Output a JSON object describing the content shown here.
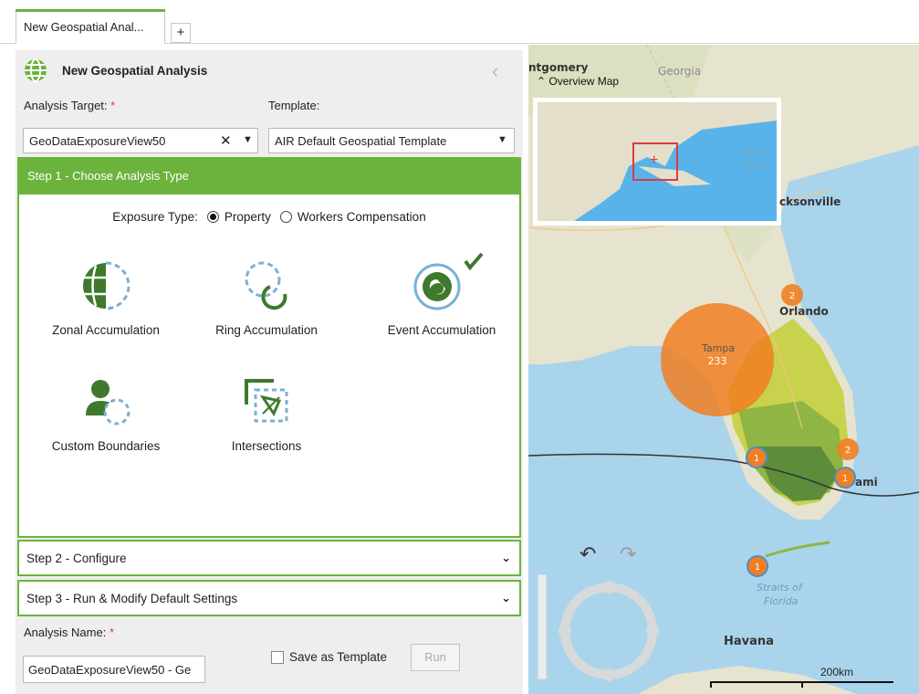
{
  "tabs": {
    "active_label": "New Geospatial Anal...",
    "add_label": "+"
  },
  "panel": {
    "title": "New Geospatial Analysis",
    "target_label": "Analysis Target:",
    "required_mark": "*",
    "target_value": "GeoDataExposureView50",
    "clear_symbol": "✕",
    "dropdown_symbol": "▼",
    "template_label": "Template:",
    "template_value": "AIR Default Geospatial Template"
  },
  "step1": {
    "title": "Step 1 - Choose Analysis Type",
    "exposure_label": "Exposure Type:",
    "exposure_options": [
      "Property",
      "Workers Compensation"
    ],
    "exposure_selected": "Property",
    "analysis_types": [
      {
        "label": "Zonal Accumulation",
        "icon": "zonal-accumulation-icon"
      },
      {
        "label": "Ring Accumulation",
        "icon": "ring-accumulation-icon"
      },
      {
        "label": "Event Accumulation",
        "icon": "event-accumulation-icon",
        "selected": true
      },
      {
        "label": "Custom Boundaries",
        "icon": "custom-boundaries-icon"
      },
      {
        "label": "Intersections",
        "icon": "intersections-icon"
      }
    ]
  },
  "step2": {
    "title": "Step 2 - Configure"
  },
  "step3": {
    "title": "Step 3 - Run & Modify Default Settings"
  },
  "footer": {
    "name_label": "Analysis Name:",
    "name_value": "GeoDataExposureView50 - Ge",
    "save_template_label": "Save as Template",
    "run_label": "Run"
  },
  "map": {
    "labels": {
      "montgomery": "ntgomery",
      "georgia": "Georgia",
      "overview_toggle": "Overview Map",
      "atlantic_1": "Atlan",
      "atlantic_2": "Ocea",
      "jacksonville": "cksonville",
      "orlando": "Orlando",
      "tampa": "Tampa",
      "miami": "ami",
      "straits_1": "Straits of",
      "straits_2": "Florida",
      "havana": "Havana",
      "scale": "200km"
    },
    "clusters": [
      {
        "name": "tampa-cluster",
        "count": "233"
      },
      {
        "name": "orlando-cluster",
        "count": "2"
      },
      {
        "name": "fort-myers-cluster",
        "count": "1"
      },
      {
        "name": "miami-north-cluster",
        "count": "2"
      },
      {
        "name": "miami-cluster",
        "count": "1"
      },
      {
        "name": "keys-cluster",
        "count": "1"
      }
    ],
    "colors": {
      "cluster": "#f07f22",
      "land": "#e6e3cf",
      "water": "#a9d4ec",
      "exposure_light": "#c9d24d",
      "exposure_dark": "#5d8c3a"
    }
  },
  "colors": {
    "accent": "#6cb33e",
    "required": "#e0393e"
  }
}
